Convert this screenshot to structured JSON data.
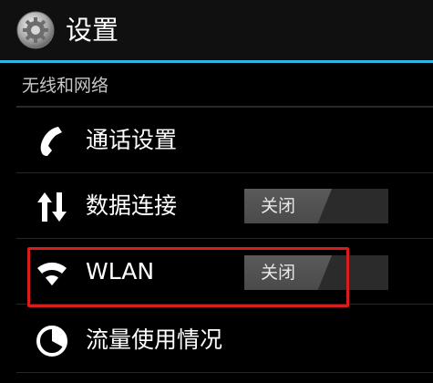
{
  "header": {
    "title": "设置",
    "icon": "settings-gear-icon",
    "accent": "#33b5e5"
  },
  "section": {
    "title": "无线和网络"
  },
  "rows": [
    {
      "label": "通话设置",
      "icon": "phone-icon"
    },
    {
      "label": "数据连接",
      "icon": "data-transfer-icon",
      "toggle": "关闭"
    },
    {
      "label": "WLAN",
      "icon": "wifi-icon",
      "toggle": "关闭"
    },
    {
      "label": "流量使用情况",
      "icon": "data-usage-icon"
    }
  ],
  "highlight_color": "#d91d1d"
}
